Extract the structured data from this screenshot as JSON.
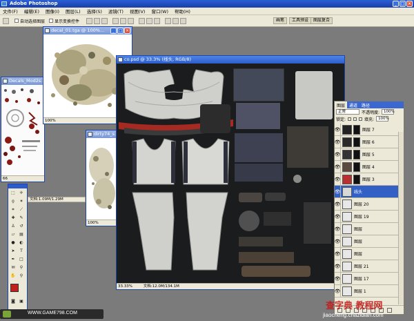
{
  "app": {
    "title": "Adobe Photoshop",
    "window_buttons": [
      "_",
      "□",
      "×"
    ]
  },
  "menu": [
    "文件(F)",
    "编辑(E)",
    "图像(I)",
    "图层(L)",
    "选择(S)",
    "滤镜(T)",
    "视图(V)",
    "窗口(W)",
    "帮助(H)"
  ],
  "options_bar": {
    "auto_select_layer": "自动选择图层",
    "show_transform_controls": "显示变换控件",
    "tabs": [
      "画笔",
      "工具预设",
      "图层复合"
    ]
  },
  "documents": [
    {
      "title": "decal_01.tga @ 100%...",
      "status": "100%"
    },
    {
      "title": "Decals_Mod2s...",
      "status": "66"
    },
    {
      "title": "dirty74_s...",
      "status": "100%"
    },
    {
      "title": "co.psd @ 33.3% (线头, RGB/8)",
      "zoom": "33.33%",
      "doc_info": "文档:12.0M/134.1M"
    }
  ],
  "decal_status_doc": "文档:1.09M/1.29M",
  "layers_panel": {
    "tabs": [
      "图层",
      "通道",
      "路径"
    ],
    "blend_mode": "正常",
    "opacity_label": "不透明度:",
    "opacity_value": "100%",
    "lock_label": "锁定:",
    "fill_label": "填充:",
    "fill_value": "100%",
    "layers": [
      {
        "name": "图层 7",
        "thumb": "#222222",
        "mask": true,
        "selected": false
      },
      {
        "name": "图层 6",
        "thumb": "#2a2a2a",
        "mask": true,
        "selected": false
      },
      {
        "name": "图层 5",
        "thumb": "#333333",
        "mask": true,
        "selected": false
      },
      {
        "name": "图层 4",
        "thumb": "#5a4a40",
        "mask": true,
        "selected": false
      },
      {
        "name": "图层 3",
        "thumb": "#b83030",
        "mask": true,
        "selected": false
      },
      {
        "name": "线头",
        "thumb": "#d8d8d8",
        "mask": false,
        "selected": true
      },
      {
        "name": "图层 20",
        "thumb": "#e8e8e8",
        "mask": false,
        "selected": false
      },
      {
        "name": "图层 19",
        "thumb": "#e8e8e8",
        "mask": false,
        "selected": false
      },
      {
        "name": "图层",
        "thumb": "#e8e8e8",
        "mask": false,
        "selected": false
      },
      {
        "name": "图层",
        "thumb": "#e8e8e8",
        "mask": false,
        "selected": false
      },
      {
        "name": "图层",
        "thumb": "#e8e8e8",
        "mask": false,
        "selected": false
      },
      {
        "name": "图层 21",
        "thumb": "#e8e8e8",
        "mask": false,
        "selected": false
      },
      {
        "name": "图层 17",
        "thumb": "#e8e8e8",
        "mask": false,
        "selected": false
      },
      {
        "name": "图层 1",
        "thumb": "#e8e8e8",
        "mask": false,
        "selected": false
      }
    ]
  },
  "toolbox": {
    "foreground_color": "#c0201c",
    "background_color": "#ffffff"
  },
  "watermarks": {
    "left": "WWW.GAME798.COM",
    "right_main": "查字典 教程网",
    "right_url": "jiaocheng.chazidian.com"
  },
  "colors": {
    "canvas_bg": "#1b1c1e",
    "workspace": "#7b7b7b",
    "title_active": "#2c5ccc",
    "selection": "#3260c5"
  }
}
